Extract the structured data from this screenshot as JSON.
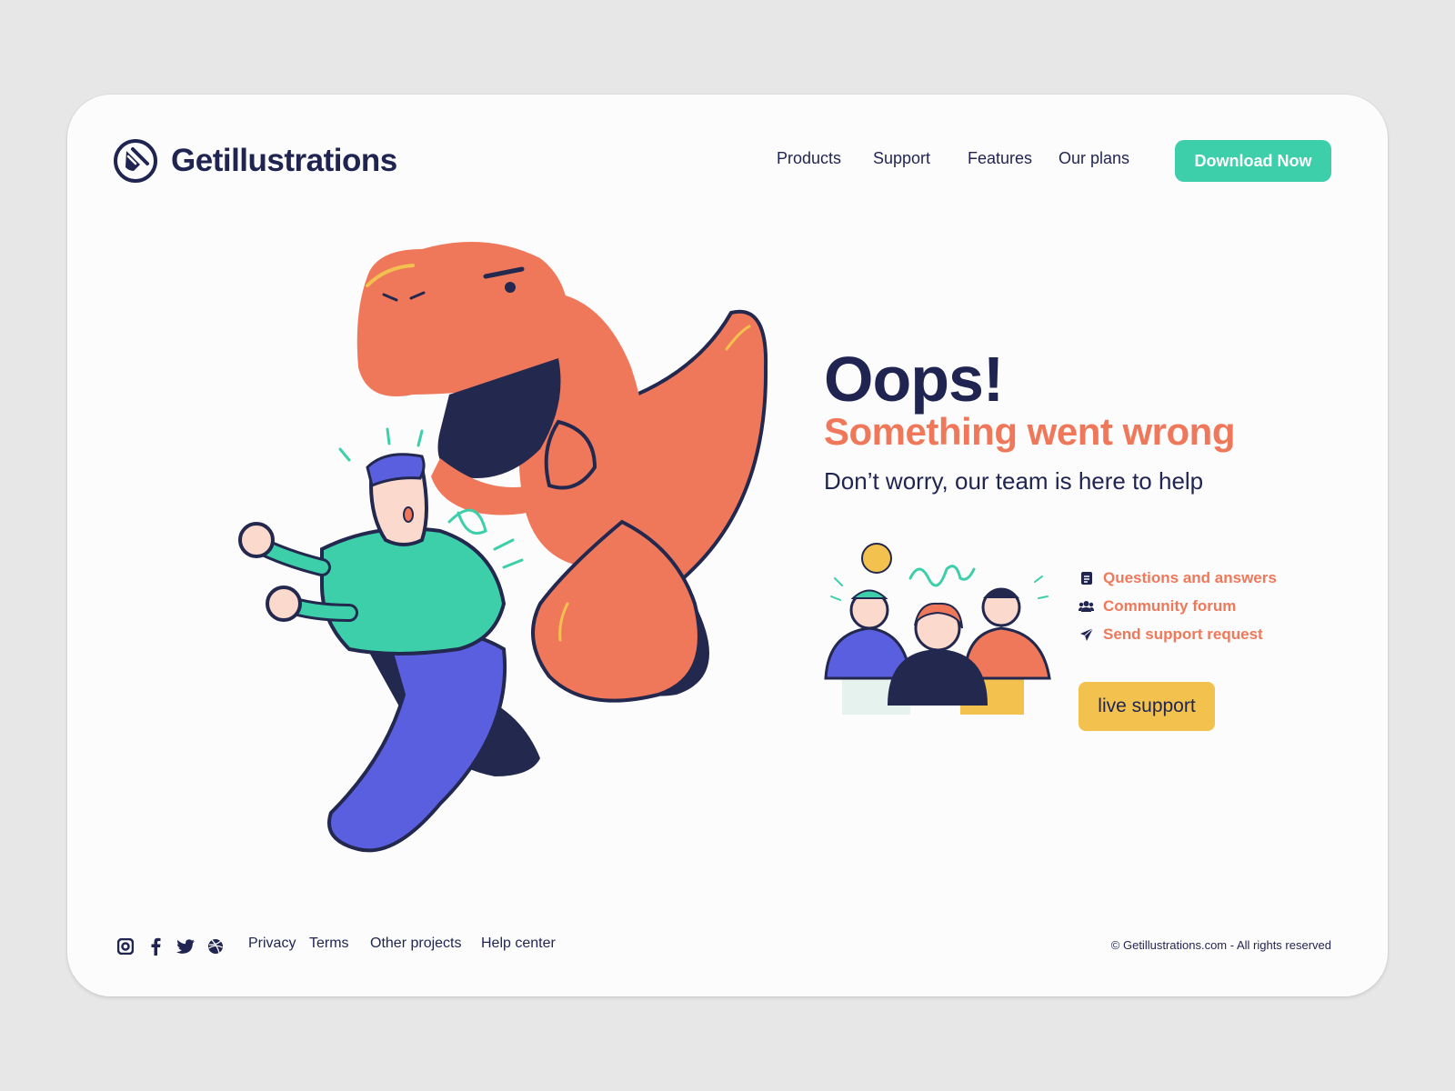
{
  "brand": {
    "name": "Getillustrations",
    "logo_icon": "pen-nib-logo-icon"
  },
  "nav": {
    "items": [
      "Products",
      "Support",
      "Features",
      "Our plans"
    ],
    "cta": "Download Now"
  },
  "hero": {
    "title": "Oops!",
    "subtitle": "Something went wrong",
    "tagline": "Don’t worry, our team is here to help"
  },
  "support": {
    "links": [
      {
        "label": "Questions and answers",
        "icon": "document-icon"
      },
      {
        "label": "Community forum",
        "icon": "people-icon"
      },
      {
        "label": "Send support request",
        "icon": "paper-plane-icon"
      }
    ],
    "live_button": "live support"
  },
  "footer": {
    "social_icons": [
      "instagram-icon",
      "facebook-icon",
      "twitter-icon",
      "dribbble-icon"
    ],
    "links": [
      "Privacy",
      "Terms",
      "Other projects",
      "Help center"
    ],
    "copyright": "© Getillustrations.com - All rights reserved"
  },
  "colors": {
    "navy": "#1f2450",
    "teal": "#3ccfaa",
    "orange": "#f0785a",
    "yellow": "#f2c14e",
    "purple": "#5a5fe0"
  }
}
